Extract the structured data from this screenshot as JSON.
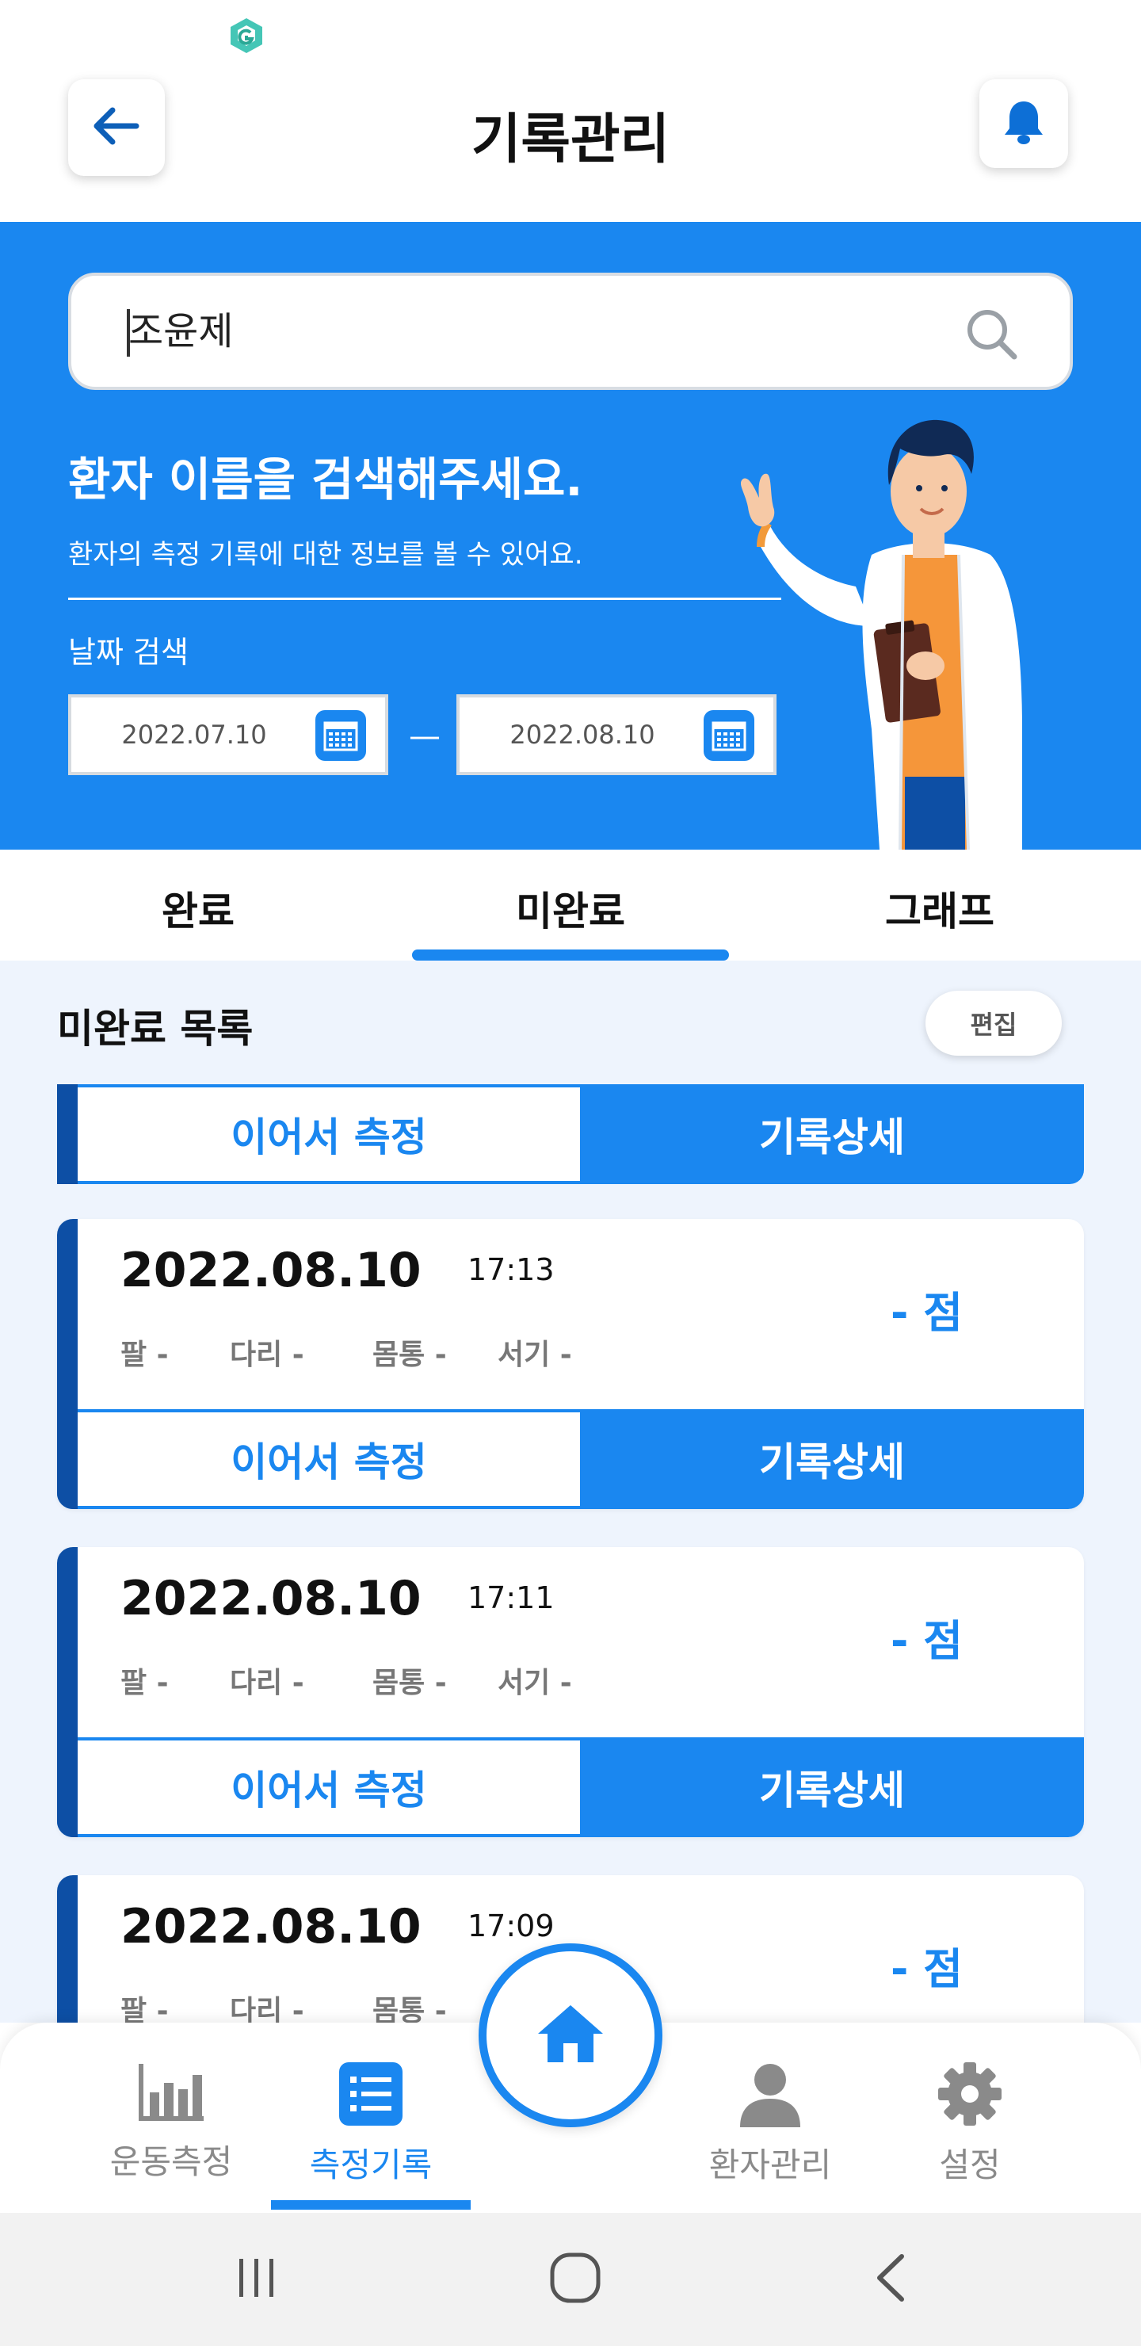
{
  "header": {
    "title": "기록관리",
    "back_icon": "arrow-left-icon",
    "bell_icon": "bell-icon"
  },
  "search": {
    "value": "조윤제",
    "icon": "search-icon"
  },
  "hero": {
    "title": "환자 이름을 검색해주세요.",
    "subtitle": "환자의 측정 기록에 대한 정보를 볼 수 있어요.",
    "date_label": "날짜 검색",
    "date_from": "2022.07.10",
    "date_to": "2022.08.10",
    "date_separator": "—",
    "background_color": "#1a87f0"
  },
  "tabs": [
    {
      "label": "완료",
      "active": false
    },
    {
      "label": "미완료",
      "active": true
    },
    {
      "label": "그래프",
      "active": false
    }
  ],
  "list": {
    "title": "미완료 목록",
    "edit_label": "편집",
    "continue_label": "이어서 측정",
    "detail_label": "기록상세",
    "records": [
      {
        "date": "2022.08.10",
        "time": "17:13",
        "score": "- 점",
        "metrics": [
          "팔 -",
          "다리 -",
          "몸통 -",
          "서기 -"
        ]
      },
      {
        "date": "2022.08.10",
        "time": "17:11",
        "score": "- 점",
        "metrics": [
          "팔 -",
          "다리 -",
          "몸통 -",
          "서기 -"
        ]
      },
      {
        "date": "2022.08.10",
        "time": "17:09",
        "score": "- 점",
        "metrics": [
          "팔 -",
          "다리 -",
          "몸통 -"
        ]
      }
    ]
  },
  "bottom_nav": [
    {
      "label": "운동측정",
      "icon": "bar-chart-icon",
      "active": false
    },
    {
      "label": "측정기록",
      "icon": "list-icon",
      "active": true
    },
    {
      "label": "환자관리",
      "icon": "person-icon",
      "active": false
    },
    {
      "label": "설정",
      "icon": "gear-icon",
      "active": false
    }
  ],
  "home_icon": "home-icon",
  "colors": {
    "primary": "#1a87f0",
    "accent_dark": "#0d4fa5",
    "list_bg": "#eef4fd"
  }
}
